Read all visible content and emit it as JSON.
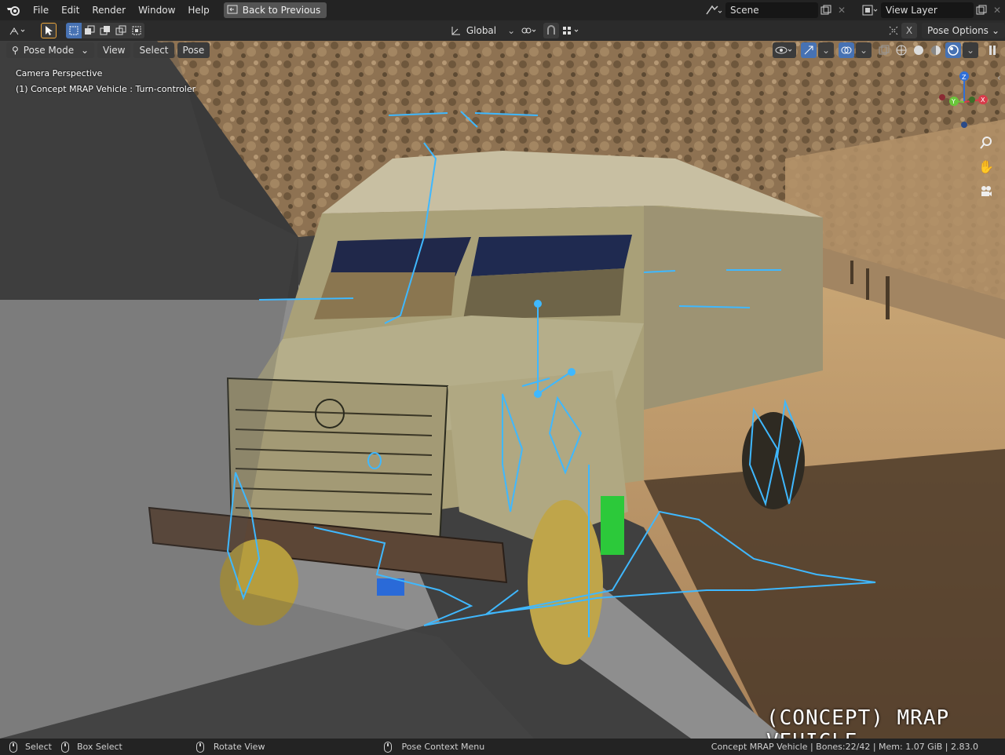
{
  "menu": {
    "file": "File",
    "edit": "Edit",
    "render": "Render",
    "window": "Window",
    "help": "Help",
    "back": "Back to Previous"
  },
  "scene": {
    "label": "Scene",
    "view_layer": "View Layer"
  },
  "tool_header": {
    "orientation": "Global",
    "pose_options": "Pose Options",
    "x_axis": "X"
  },
  "viewport_header": {
    "mode": "Pose Mode",
    "view": "View",
    "select": "Select",
    "pose": "Pose"
  },
  "overlay": {
    "line1": "Camera Perspective",
    "line2": "(1) Concept MRAP Vehicle : Turn-controler",
    "watermark": "(CONCEPT) MRAP VEHICLE"
  },
  "gizmo": {
    "x": "X",
    "y": "Y",
    "z": "Z"
  },
  "status": {
    "select": "Select",
    "box_select": "Box Select",
    "rotate_view": "Rotate View",
    "pose_context": "Pose Context Menu",
    "info": "Concept MRAP Vehicle | Bones:22/42 | Mem: 1.07 GiB | 2.83.0"
  },
  "colors": {
    "accent": "#4772b3",
    "rig": "#3fb8ff",
    "topbar": "#232323",
    "header": "#2b2b2b"
  }
}
